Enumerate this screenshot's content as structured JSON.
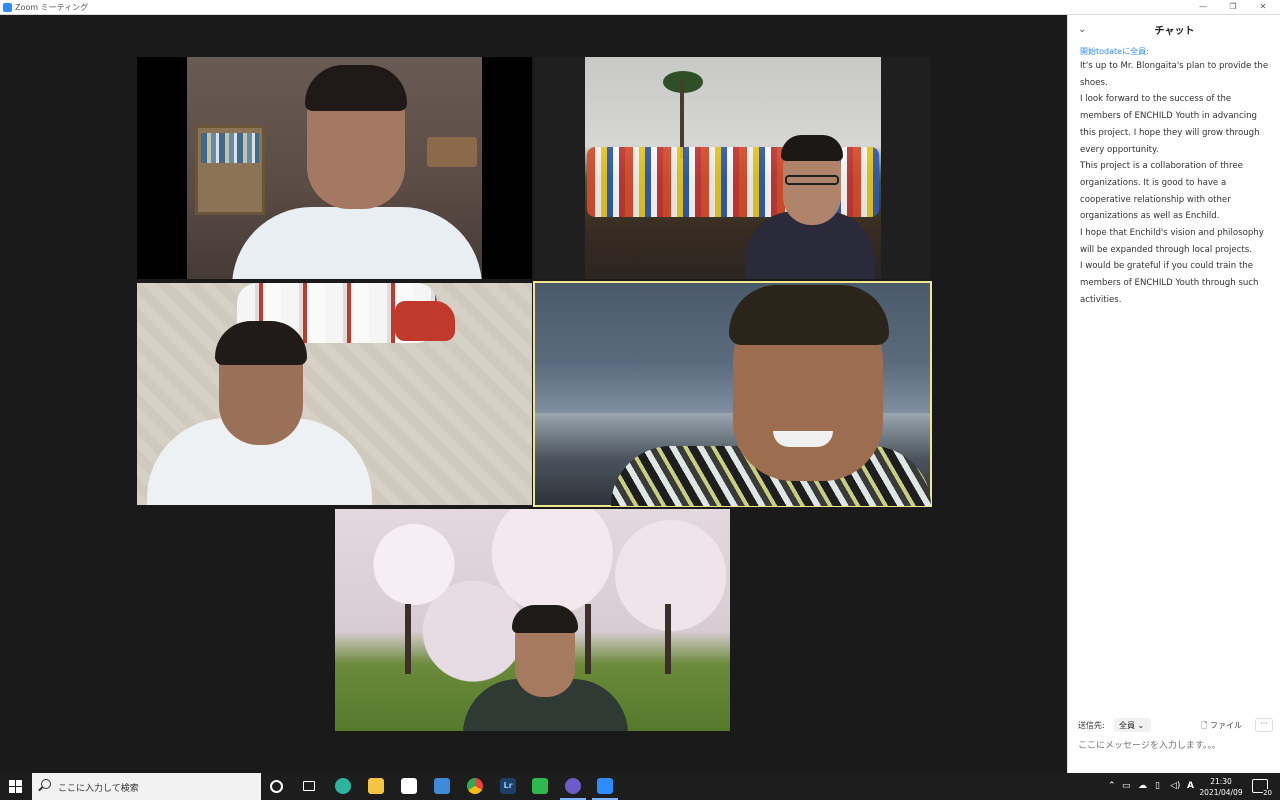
{
  "window": {
    "title": "Zoom ミーティング",
    "minimize": "—",
    "restore": "❐",
    "close": "✕"
  },
  "video_tiles": [
    {
      "id": "t1",
      "participant": "",
      "active": false
    },
    {
      "id": "t2",
      "participant": "",
      "active": false
    },
    {
      "id": "t3",
      "participant": "",
      "active": false
    },
    {
      "id": "t4",
      "participant": "",
      "active": true
    },
    {
      "id": "t5",
      "participant": "",
      "active": false
    }
  ],
  "chat": {
    "collapse_icon": "⌄",
    "heading": "チャット",
    "sender_line": "開始todateに全員:",
    "messages": [
      "It's up to Mr. Blongaita's plan to provide the shoes.",
      "I look forward to the success of the members of ENCHILD Youth in advancing this project. I hope they will grow through every opportunity.",
      "This project is a collaboration of three organizations. It is good to have a cooperative relationship with other organizations as well as Enchild.",
      "I hope that Enchild's vision and philosophy will be expanded through local projects.",
      "I would be grateful if you could train the members of ENCHILD Youth through such activities."
    ],
    "to_label": "送信先:",
    "to_value": "全員 ⌄",
    "file_label": "ファイル",
    "more_label": "···",
    "input_placeholder": "ここにメッセージを入力します。。。"
  },
  "taskbar": {
    "search_placeholder": "ここに入力して検索",
    "time": "21:30",
    "date": "2021/04/09",
    "notification_count": "20",
    "tray_ime": "A",
    "apps": [
      {
        "name": "cortana-icon",
        "color": "#ffffff"
      },
      {
        "name": "task-view-icon",
        "color": "#ffffff"
      },
      {
        "name": "edge-icon",
        "color": "#2bb5a0"
      },
      {
        "name": "file-explorer-icon",
        "color": "#f4c542"
      },
      {
        "name": "store-icon",
        "color": "#ffffff"
      },
      {
        "name": "mail-icon",
        "color": "#3d8bd9"
      },
      {
        "name": "chrome-icon",
        "color": "#e8453c"
      },
      {
        "name": "lightroom-icon",
        "color": "#1f3f66"
      },
      {
        "name": "line-icon",
        "color": "#2fb84d"
      },
      {
        "name": "screen-capture-icon",
        "color": "#6c5cc9"
      },
      {
        "name": "zoom-icon",
        "color": "#2d8cff"
      }
    ]
  }
}
